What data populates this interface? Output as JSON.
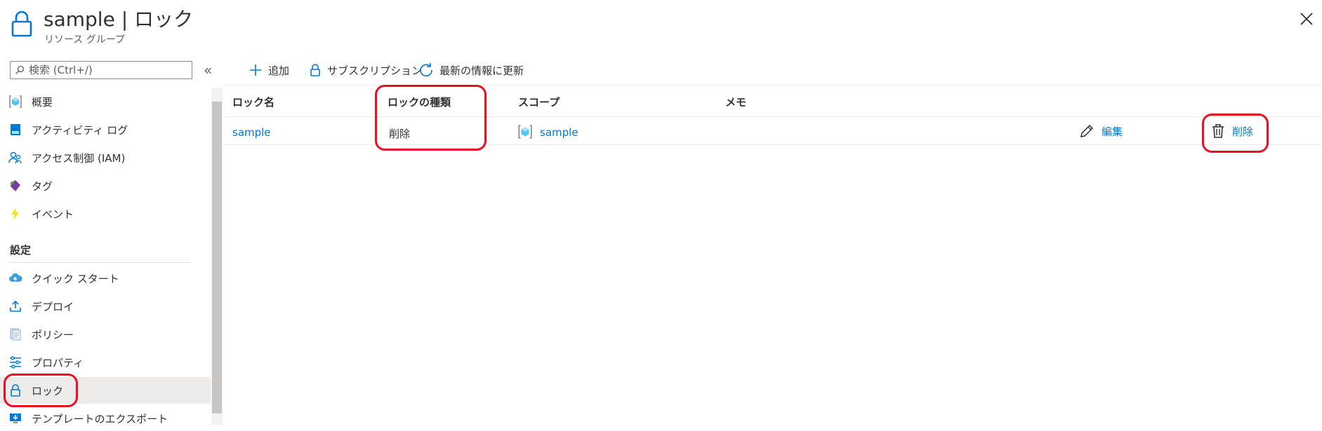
{
  "header": {
    "title": "sample | ロック",
    "subtitle": "リソース グループ"
  },
  "search": {
    "placeholder": "検索 (Ctrl+/)",
    "collapse_glyph": "«"
  },
  "sidebar": {
    "items": [
      {
        "label": "概要",
        "icon": "resource-group-icon"
      },
      {
        "label": "アクティビティ ログ",
        "icon": "activity-log-icon"
      },
      {
        "label": "アクセス制御 (IAM)",
        "icon": "iam-icon"
      },
      {
        "label": "タグ",
        "icon": "tag-icon"
      },
      {
        "label": "イベント",
        "icon": "lightning-icon"
      }
    ],
    "section_header": "設定",
    "settings_items": [
      {
        "label": "クイック スタート",
        "icon": "cloud-icon"
      },
      {
        "label": "デプロイ",
        "icon": "upload-icon"
      },
      {
        "label": "ポリシー",
        "icon": "policy-icon"
      },
      {
        "label": "プロパティ",
        "icon": "sliders-icon"
      },
      {
        "label": "ロック",
        "icon": "lock-icon",
        "selected": true
      },
      {
        "label": "テンプレートのエクスポート",
        "icon": "download-icon"
      }
    ]
  },
  "toolbar": {
    "add_label": "追加",
    "subscription_label": "サブスクリプション",
    "refresh_label": "最新の情報に更新"
  },
  "table": {
    "headers": [
      "ロック名",
      "ロックの種類",
      "スコープ",
      "メモ"
    ],
    "rows": [
      {
        "name": "sample",
        "type": "削除",
        "scope": "sample",
        "note": "",
        "edit_label": "編集",
        "delete_label": "削除"
      }
    ]
  },
  "colors": {
    "accent": "#0078d4",
    "highlight": "#e81123",
    "selected_bg": "#edebe9"
  }
}
